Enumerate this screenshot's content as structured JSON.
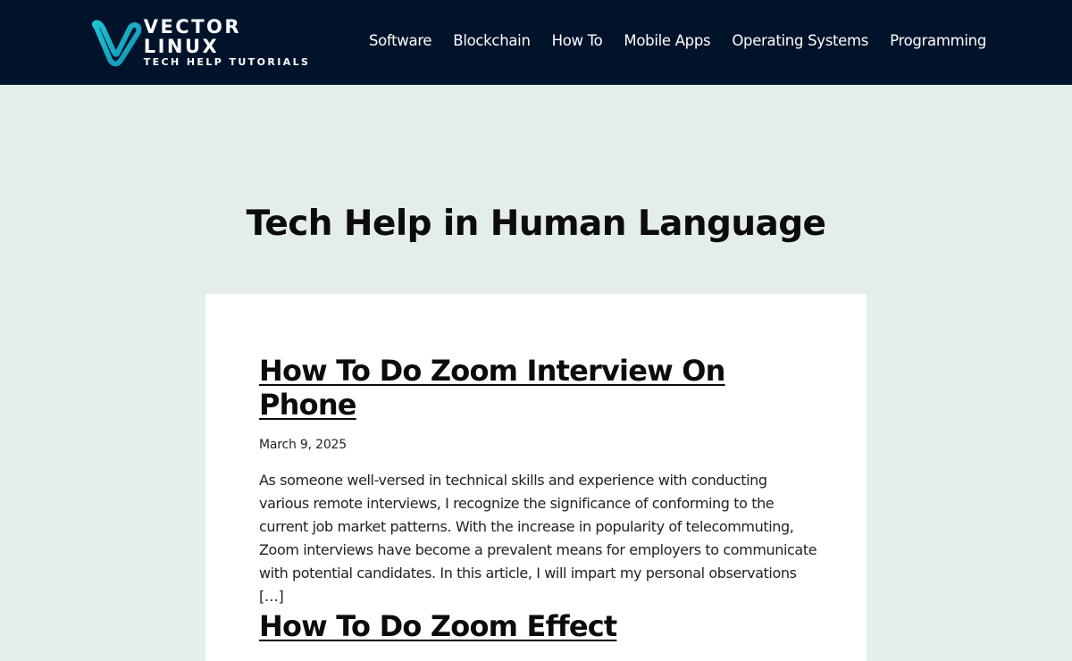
{
  "header": {
    "logo": {
      "title": "VECTOR LINUX",
      "subtitle": "TECH HELP TUTORIALS",
      "icon": "v-logo-icon",
      "accent_color": "#1ab5c9"
    },
    "nav": [
      {
        "label": "Software"
      },
      {
        "label": "Blockchain"
      },
      {
        "label": "How To"
      },
      {
        "label": "Mobile Apps"
      },
      {
        "label": "Operating Systems"
      },
      {
        "label": "Programming"
      }
    ]
  },
  "hero": {
    "title": "Tech Help in Human Language"
  },
  "posts": [
    {
      "title": "How To Do Zoom Interview On Phone",
      "date": "March 9, 2025",
      "excerpt": "As someone well-versed in technical skills and experience with conducting various remote interviews, I recognize the significance of conforming to the current job market patterns. With the increase in popularity of telecommuting, Zoom interviews have become a prevalent means for employers to communicate with potential candidates. In this article, I will impart my personal observations […]"
    },
    {
      "title": "How To Do Zoom Effect"
    }
  ]
}
